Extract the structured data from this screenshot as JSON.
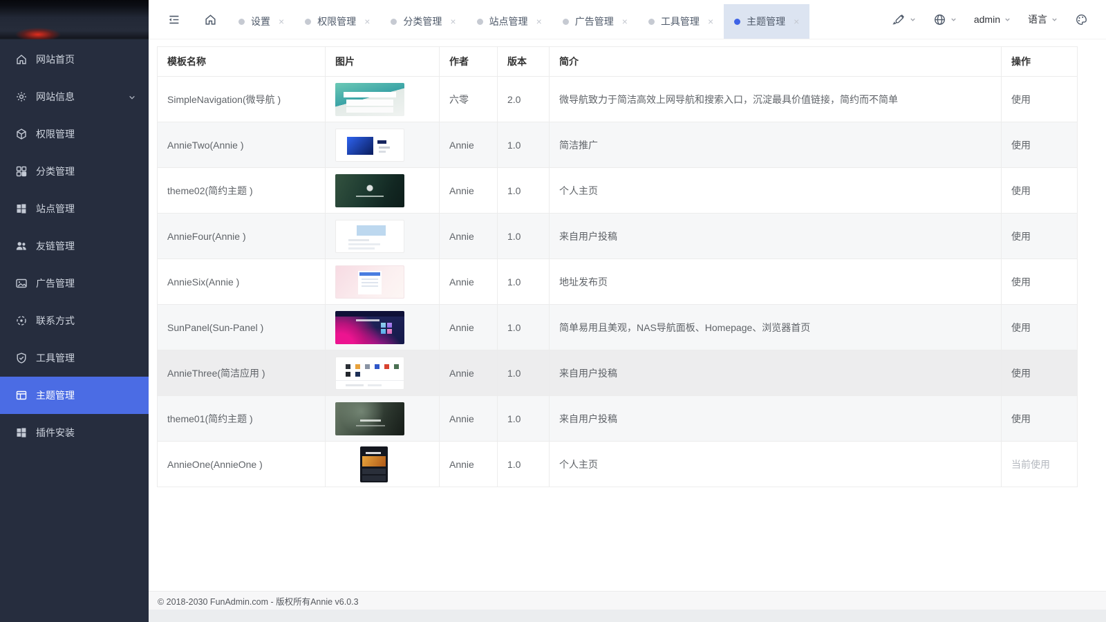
{
  "colors": {
    "accent": "#4b6ce4",
    "sidebar_bg": "#262d3e",
    "active_tab_bg": "#dce4f1",
    "active_tab_dot": "#3e63e6"
  },
  "sidebar": {
    "items": [
      {
        "label": "网站首页",
        "icon": "home-icon"
      },
      {
        "label": "网站信息",
        "icon": "gear-icon",
        "expandable": true
      },
      {
        "label": "权限管理",
        "icon": "cube-icon"
      },
      {
        "label": "分类管理",
        "icon": "category-icon"
      },
      {
        "label": "站点管理",
        "icon": "site-icon"
      },
      {
        "label": "友链管理",
        "icon": "users-icon"
      },
      {
        "label": "广告管理",
        "icon": "image-icon"
      },
      {
        "label": "联系方式",
        "icon": "contact-icon"
      },
      {
        "label": "工具管理",
        "icon": "shield-icon"
      },
      {
        "label": "主题管理",
        "icon": "layout-icon",
        "active": true
      },
      {
        "label": "插件安装",
        "icon": "plugin-icon"
      }
    ]
  },
  "topbar": {
    "close_glyph": "×",
    "tabs": [
      {
        "label": "设置"
      },
      {
        "label": "权限管理"
      },
      {
        "label": "分类管理"
      },
      {
        "label": "站点管理"
      },
      {
        "label": "广告管理"
      },
      {
        "label": "工具管理"
      },
      {
        "label": "主题管理",
        "active": true
      }
    ],
    "user": "admin",
    "language_label": "语言"
  },
  "table": {
    "headers": [
      "模板名称",
      "图片",
      "作者",
      "版本",
      "简介",
      "操作"
    ],
    "rows": [
      {
        "name": "SimpleNavigation(微导航 )",
        "author": "六零",
        "version": "2.0",
        "intro": "微导航致力于简洁高效上网导航和搜索入口，沉淀最具价值链接，简约而不简单",
        "action": "使用",
        "thumb": "simplenav"
      },
      {
        "name": "AnnieTwo(Annie )",
        "author": "Annie",
        "version": "1.0",
        "intro": "简洁推广",
        "action": "使用",
        "thumb": "annietwo"
      },
      {
        "name": "theme02(简约主题 )",
        "author": "Annie",
        "version": "1.0",
        "intro": "个人主页",
        "action": "使用",
        "thumb": "theme02"
      },
      {
        "name": "AnnieFour(Annie )",
        "author": "Annie",
        "version": "1.0",
        "intro": "来自用户投稿",
        "action": "使用",
        "thumb": "anniefour"
      },
      {
        "name": "AnnieSix(Annie )",
        "author": "Annie",
        "version": "1.0",
        "intro": "地址发布页",
        "action": "使用",
        "thumb": "anniesix"
      },
      {
        "name": "SunPanel(Sun-Panel )",
        "author": "Annie",
        "version": "1.0",
        "intro": "简单易用且美观，NAS导航面板、Homepage、浏览器首页",
        "action": "使用",
        "thumb": "sunpanel"
      },
      {
        "name": "AnnieThree(简洁应用 )",
        "author": "Annie",
        "version": "1.0",
        "intro": "来自用户投稿",
        "action": "使用",
        "thumb": "anniethree"
      },
      {
        "name": "theme01(简约主题 )",
        "author": "Annie",
        "version": "1.0",
        "intro": "来自用户投稿",
        "action": "使用",
        "thumb": "theme01"
      },
      {
        "name": "AnnieOne(AnnieOne )",
        "author": "Annie",
        "version": "1.0",
        "intro": "个人主页",
        "action": "当前使用",
        "thumb": "annieone",
        "current": true
      }
    ]
  },
  "footer": {
    "copyright": "© 2018-2030 FunAdmin.com - 版权所有Annie v6.0.3"
  }
}
